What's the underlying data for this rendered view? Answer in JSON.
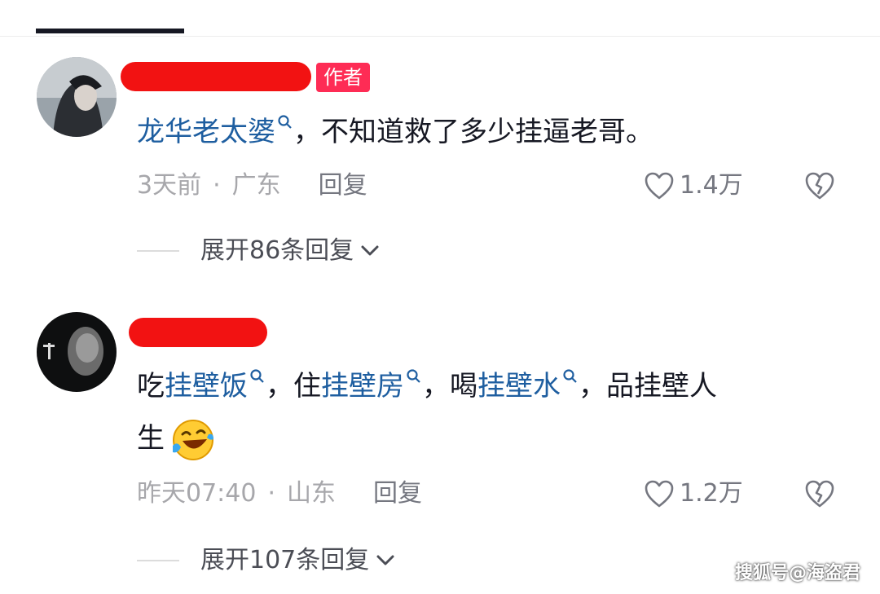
{
  "comments": [
    {
      "author_badge": "作者",
      "text_parts": [
        {
          "t": "龙华老太婆",
          "kw": true
        },
        {
          "t": "，不知道救了多少挂逼老哥。",
          "kw": false
        }
      ],
      "time": "3天前",
      "location": "广东",
      "reply_label": "回复",
      "likes": "1.4万",
      "expand_label": "展开86条回复"
    },
    {
      "text_line1_parts": [
        {
          "t": "吃",
          "kw": false
        },
        {
          "t": "挂壁饭",
          "kw": true
        },
        {
          "t": "，住",
          "kw": false
        },
        {
          "t": "挂壁房",
          "kw": true
        },
        {
          "t": "，喝",
          "kw": false
        },
        {
          "t": "挂壁水",
          "kw": true
        },
        {
          "t": "，品挂壁人",
          "kw": false
        }
      ],
      "text_line2": "生",
      "time": "昨天07:40",
      "location": "山东",
      "reply_label": "回复",
      "likes": "1.2万",
      "expand_label": "展开107条回复"
    }
  ],
  "watermark": "搜狐号@海盗君",
  "icons": {
    "search_hint": "search-icon",
    "like": "heart-outline-icon",
    "dislike": "broken-heart-icon",
    "expand": "chevron-down-icon"
  },
  "colors": {
    "keyword": "#1e5ea0",
    "badge": "#fe2c55",
    "redaction": "#f21212"
  }
}
